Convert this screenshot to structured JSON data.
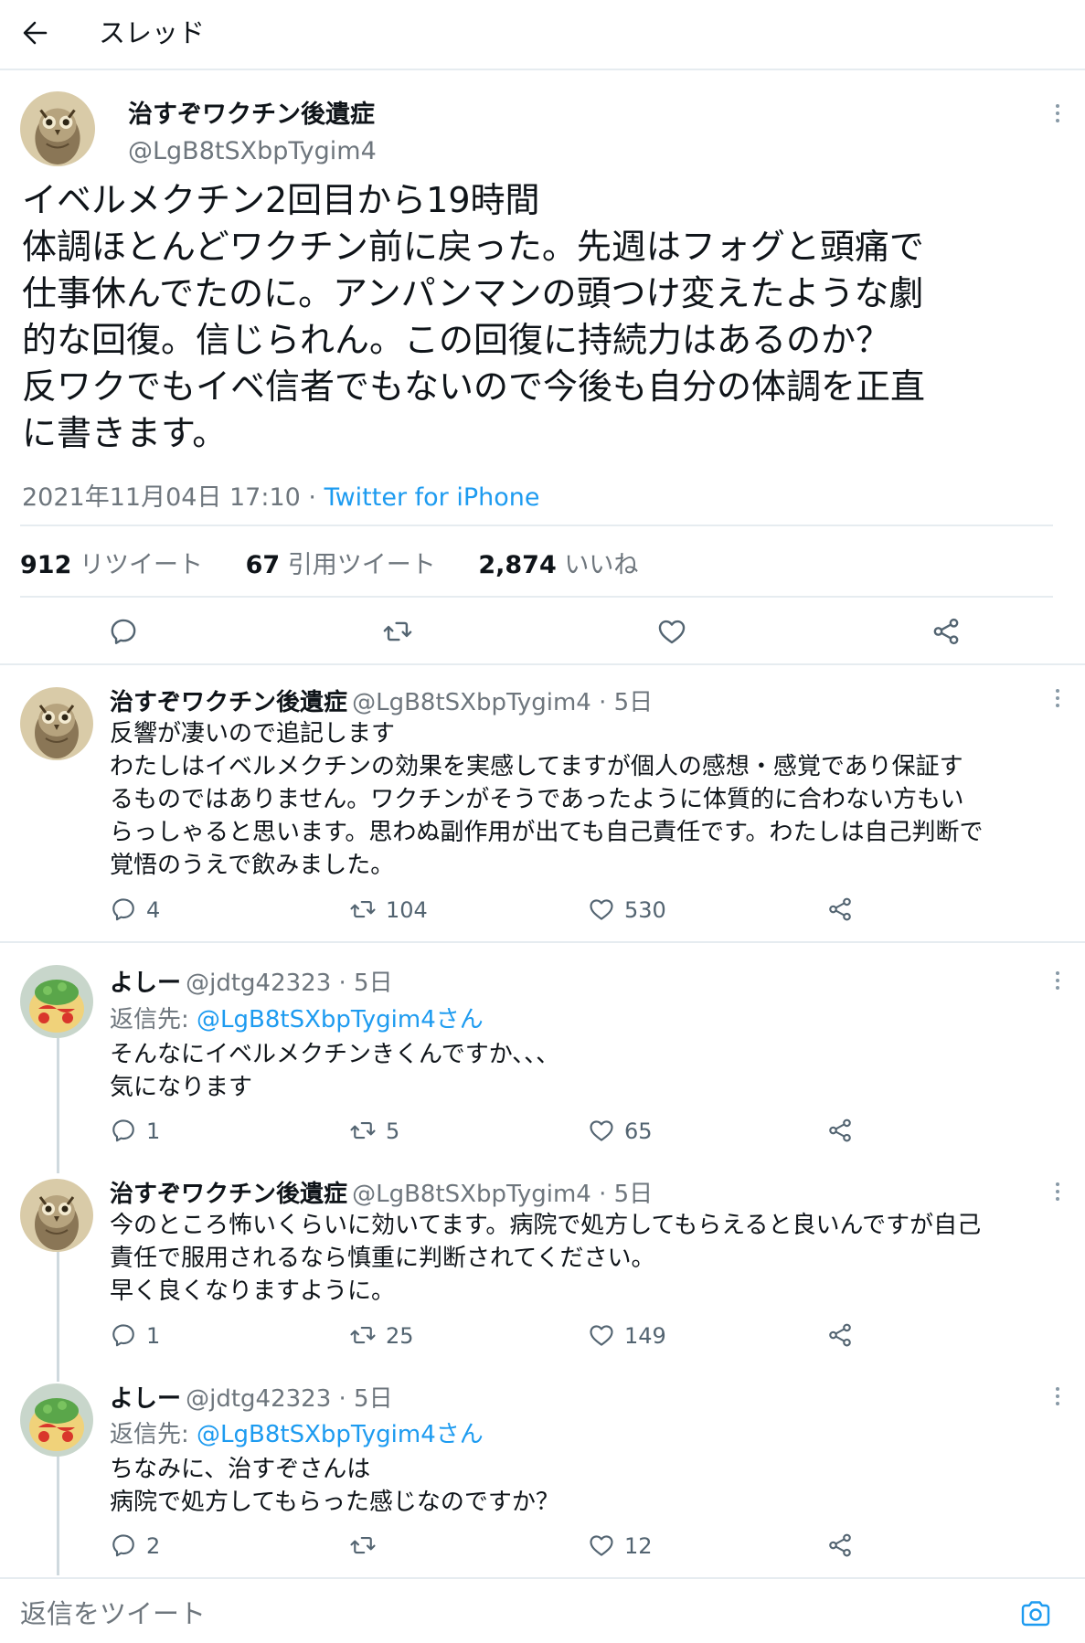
{
  "header": {
    "title": "スレッド"
  },
  "main_tweet": {
    "name": "治すぞワクチン後遺症",
    "handle": "@LgB8tSXbpTygim4",
    "text": "イベルメクチン2回目から19時間\n体調ほとんどワクチン前に戻った。先週はフォグと頭痛で\n仕事休んでたのに。アンパンマンの頭つけ変えたような劇\n的な回復。信じられん。この回復に持続力はあるのか？\n反ワクでもイベ信者でもないので今後も自分の体調を正直\nに書きます。",
    "timestamp": "2021年11月04日 17:10",
    "separator": " · ",
    "source": "Twitter for iPhone",
    "retweets": {
      "count": "912",
      "label": "リツイート"
    },
    "quotes": {
      "count": "67",
      "label": "引用ツイート"
    },
    "likes": {
      "count": "2,874",
      "label": "いいね"
    }
  },
  "replies": [
    {
      "name": "治すぞワクチン後遺症",
      "handle_time": "@LgB8tSXbpTygim4 · 5日",
      "reply_to_prefix": "",
      "reply_to_handle": "",
      "text": "反響が凄いので追記します\nわたしはイベルメクチンの効果を実感してますが個人の感想・感覚であり保証す\nるものではありません。ワクチンがそうであったように体質的に合わない方もい\nらっしゃると思います。思わぬ副作用が出ても自己責任です。わたしは自己判断で\n覚悟のうえで飲みました。",
      "replies_count": "4",
      "retweets_count": "104",
      "likes_count": "530"
    },
    {
      "name": "よしー",
      "handle_time": "@jdtg42323 · 5日",
      "reply_to_prefix": "返信先: ",
      "reply_to_handle": "@LgB8tSXbpTygim4さん",
      "text": "そんなにイベルメクチンきくんですか、、、\n気になります",
      "replies_count": "1",
      "retweets_count": "5",
      "likes_count": "65"
    },
    {
      "name": "治すぞワクチン後遺症",
      "handle_time": "@LgB8tSXbpTygim4 · 5日",
      "reply_to_prefix": "",
      "reply_to_handle": "",
      "text": "今のところ怖いくらいに効いてます。病院で処方してもらえると良いんですが自己\n責任で服用されるなら慎重に判断されてください。\n早く良くなりますように。",
      "replies_count": "1",
      "retweets_count": "25",
      "likes_count": "149"
    },
    {
      "name": "よしー",
      "handle_time": "@jdtg42323 · 5日",
      "reply_to_prefix": "返信先: ",
      "reply_to_handle": "@LgB8tSXbpTygim4さん",
      "text": "ちなみに、治すぞさんは\n病院で処方してもらった感じなのですか？",
      "replies_count": "2",
      "retweets_count": "",
      "likes_count": "12"
    }
  ],
  "reply_bar": {
    "placeholder": "返信をツイート"
  },
  "colors": {
    "accent": "#1d9bf0",
    "muted_text": "#6e767d",
    "divider": "#e6ecf0",
    "thread_line": "#cfd9de"
  },
  "icons": {
    "back": "arrow-left-icon",
    "more": "more-vertical-icon",
    "reply": "reply-icon",
    "retweet": "retweet-icon",
    "like": "heart-icon",
    "share": "share-icon",
    "camera": "camera-icon"
  }
}
